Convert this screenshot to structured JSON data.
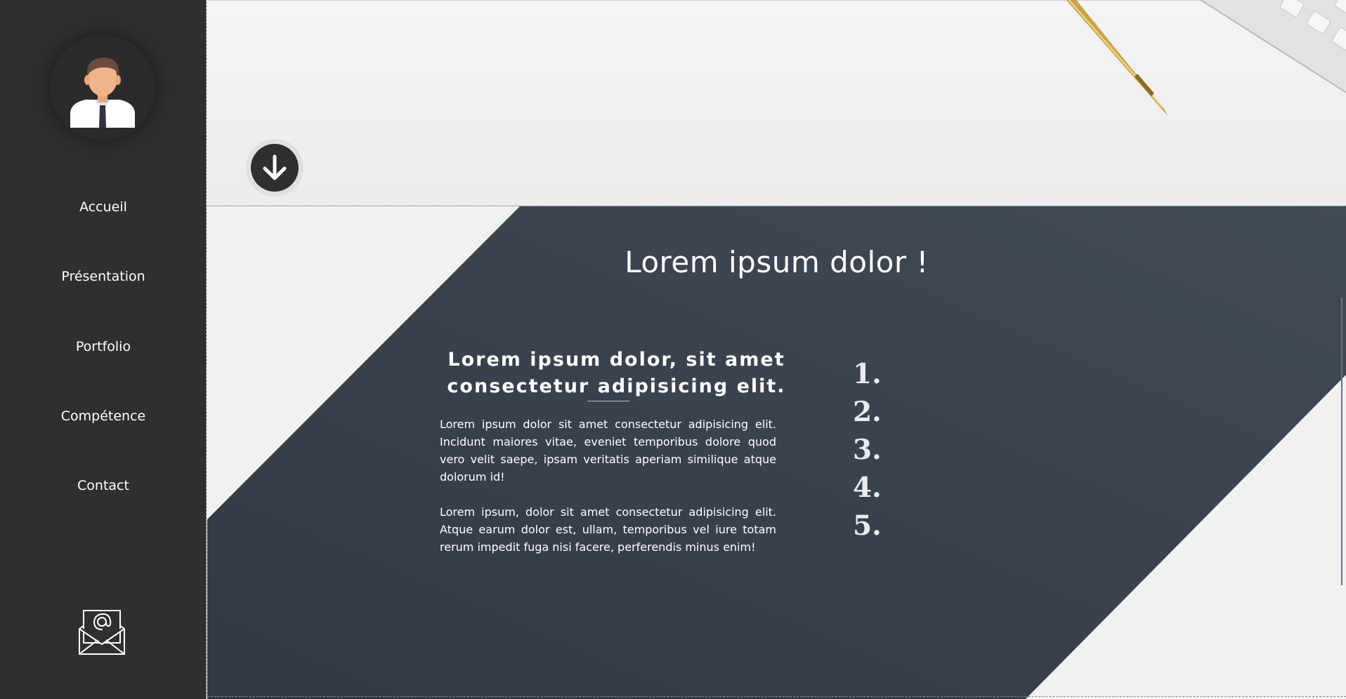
{
  "sidebar": {
    "nav": [
      {
        "label": "Accueil"
      },
      {
        "label": "Présentation"
      },
      {
        "label": "Portfolio"
      },
      {
        "label": "Compétence"
      },
      {
        "label": "Contact"
      }
    ],
    "icons": {
      "avatar": "user-avatar-icon",
      "contact": "mail-at-icon"
    }
  },
  "hero": {
    "scroll_icon": "arrow-down-icon"
  },
  "section": {
    "title": "Lorem ipsum dolor !",
    "subtitle": "Lorem ipsum dolor, sit amet consectetur adipisicing elit.",
    "paragraphs": [
      "Lorem ipsum dolor sit amet consectetur adipisicing elit. Incidunt maiores vitae, eveniet temporibus dolore quod vero velit saepe, ipsam veritatis aperiam similique atque dolorum id!",
      "Lorem ipsum, dolor sit amet consectetur adipisicing elit. Atque earum dolor est, ullam, temporibus vel iure totam rerum impedit fuga nisi facere, perferendis minus enim!"
    ],
    "numbers": [
      "1.",
      "2.",
      "3.",
      "4.",
      "5."
    ]
  },
  "colors": {
    "sidebar": "#2f2f2f",
    "panel": "#3b4450",
    "background": "#f1f1f1",
    "text_light": "#ffffff"
  }
}
